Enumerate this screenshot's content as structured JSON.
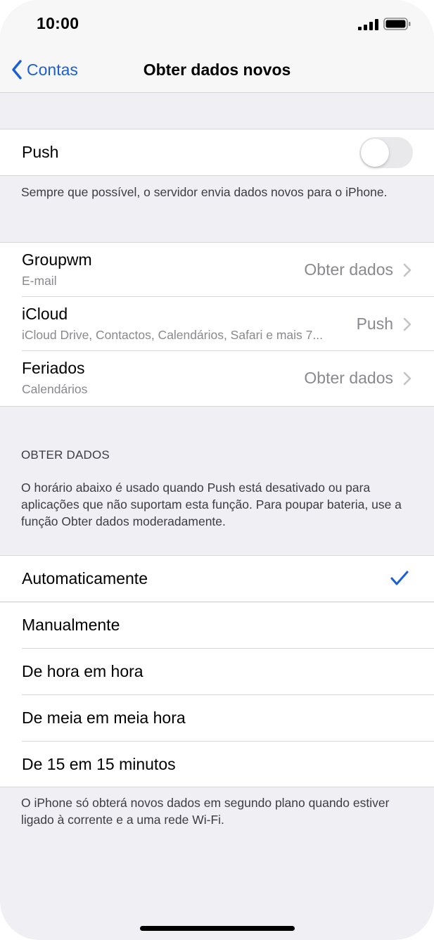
{
  "status": {
    "time": "10:00",
    "signal_icon": "cellular-signal-icon",
    "battery_icon": "battery-icon"
  },
  "nav": {
    "back_label": "Contas",
    "title": "Obter dados novos"
  },
  "push_section": {
    "label": "Push",
    "toggle_on": false,
    "footer": "Sempre que possível, o servidor envia dados novos para o iPhone."
  },
  "accounts": [
    {
      "title": "Groupwm",
      "subtitle": "E-mail",
      "value": "Obter dados"
    },
    {
      "title": "iCloud",
      "subtitle": "iCloud Drive, Contactos, Calendários, Safari e mais 7...",
      "value": "Push"
    },
    {
      "title": "Feriados",
      "subtitle": "Calendários",
      "value": "Obter dados"
    }
  ],
  "fetch_section": {
    "header": "OBTER DADOS",
    "description": "O horário abaixo é usado quando Push está desativado ou para aplicações que não suportam esta função. Para poupar bateria, use a função Obter dados moderadamente.",
    "options": [
      {
        "label": "Automaticamente",
        "selected": true
      },
      {
        "label": "Manualmente",
        "selected": false
      },
      {
        "label": "De hora em hora",
        "selected": false
      },
      {
        "label": "De meia em meia hora",
        "selected": false
      },
      {
        "label": "De 15 em 15 minutos",
        "selected": false
      }
    ],
    "footer": "O iPhone só obterá novos dados em segundo plano quando estiver ligado à corrente e a uma rede Wi-Fi."
  },
  "colors": {
    "accent": "#1a5fd6",
    "grouped_background": "#efeff4",
    "secondary_text": "#8a8a8e"
  }
}
